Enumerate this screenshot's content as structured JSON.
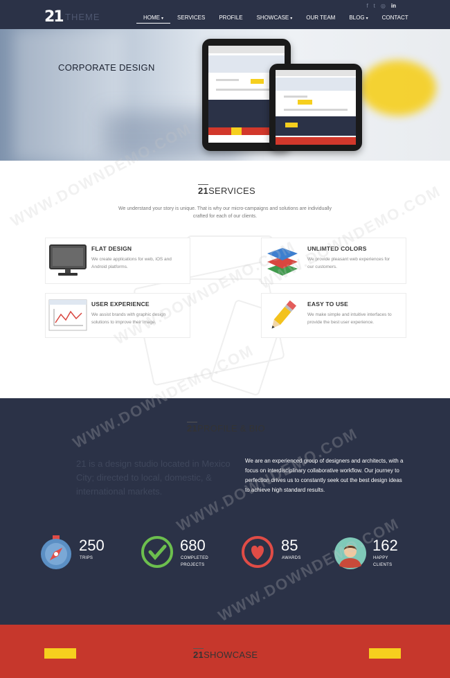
{
  "brand": {
    "mark": "21",
    "word": "THEME"
  },
  "nav": {
    "items": [
      {
        "label": "HOME",
        "caret": "▾",
        "active": true
      },
      {
        "label": "SERVICES"
      },
      {
        "label": "PROFILE"
      },
      {
        "label": "SHOWCASE",
        "caret": "▾"
      },
      {
        "label": "OUR TEAM"
      },
      {
        "label": "BLOG",
        "caret": "▾"
      },
      {
        "label": "CONTACT"
      }
    ],
    "social": [
      "f",
      "t",
      "◎",
      "in"
    ]
  },
  "hero": {
    "title": "CORPORATE DESIGN"
  },
  "services": {
    "title_mark": "21",
    "title_text": "SERVICES",
    "intro": "We understand your story is unique. That is why our micro-campaigns and solutions are individually crafted for each of our clients.",
    "cards": [
      {
        "title": "FLAT DESIGN",
        "desc": "We create applications for web, iOS and Android platforms.",
        "icon": "monitor-icon"
      },
      {
        "title": "UNLIMTED COLORS",
        "desc": "We provide pleasant web experiences for our customers.",
        "icon": "layers-icon"
      },
      {
        "title": "USER EXPERIENCE",
        "desc": "We assist brands with graphic design solutions to improve their image.",
        "icon": "chart-window-icon"
      },
      {
        "title": "EASY TO USE",
        "desc": "We make simple and intuitive interfaces to provide the best user experience.",
        "icon": "pencil-icon"
      }
    ]
  },
  "profile": {
    "title_mark": "21",
    "title_text": "PROFILE & BIO",
    "quote": "21 is a design studio located in Mexico City; directed to local, domestic, & international markets.",
    "bio": "We are an experienced group of designers and architects, with a focus on interdisciplinary collaborative workflow. Our journey to perfection drives us to constantly seek out the best design ideas to achieve high standard results.",
    "stats": [
      {
        "value": "250",
        "label": "TRIPS",
        "icon": "compass-icon",
        "color": "#5b8fc4"
      },
      {
        "value": "680",
        "label": "COMPLETED PROJECTS",
        "icon": "checkmark-icon",
        "color": "#6cbf4e"
      },
      {
        "value": "85",
        "label": "AWARDS",
        "icon": "heart-icon",
        "color": "#e04c46"
      },
      {
        "value": "162",
        "label": "HAPPY CLIENTS",
        "icon": "avatar-icon",
        "color": "#7fc9b8"
      }
    ]
  },
  "showcase": {
    "title_mark": "21",
    "title_text": "SHOWCASE"
  },
  "watermark": "WWW.DOWNDEMO.COM",
  "colors": {
    "navy": "#2b3247",
    "red": "#c6372c",
    "yellow": "#f6cf1e"
  }
}
